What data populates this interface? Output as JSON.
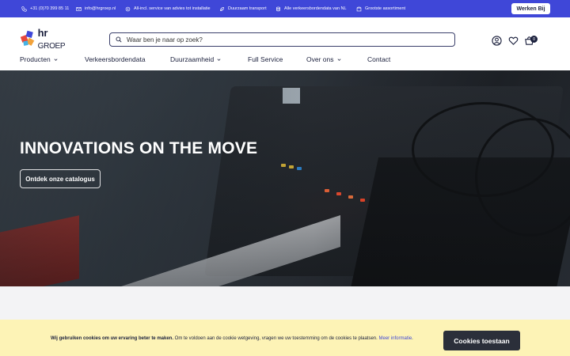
{
  "topbar": {
    "items": [
      {
        "icon": "phone-icon",
        "label": "+31 (0)70 399 85 11"
      },
      {
        "icon": "mail-icon",
        "label": "info@hrgroep.nl"
      },
      {
        "icon": "service-icon",
        "label": "All-incl. service van advies tot installatie"
      },
      {
        "icon": "leaf-icon",
        "label": "Duurzaam transport"
      },
      {
        "icon": "database-icon",
        "label": "Alle verkeersbordendata van NL"
      },
      {
        "icon": "box-icon",
        "label": "Grootste assortiment"
      }
    ],
    "werken_bij": "Werken Bij"
  },
  "logo": {
    "text": "hr",
    "subtext": "GROEP"
  },
  "search": {
    "placeholder": "Waar ben je naar op zoek?"
  },
  "cart": {
    "count": "0"
  },
  "nav": {
    "items": [
      {
        "label": "Producten",
        "dropdown": true
      },
      {
        "label": "Verkeersbordendata",
        "dropdown": false
      },
      {
        "label": "Duurzaamheid",
        "dropdown": true
      },
      {
        "label": "Full Service",
        "dropdown": false
      },
      {
        "label": "Over ons",
        "dropdown": true
      },
      {
        "label": "Contact",
        "dropdown": false
      }
    ]
  },
  "hero": {
    "title": "INNOVATIONS ON THE MOVE",
    "button": "Ontdek onze catalogus"
  },
  "cookie": {
    "bold_text": "Wij gebruiken cookies om uw ervaring beter te maken.",
    "text": " Om te voldoen aan de cookie wetgeving, vragen we uw toestemming om de cookies te plaatsen. ",
    "link": "Meer informatie",
    "link_suffix": ".",
    "button": "Cookies toestaan"
  },
  "colors": {
    "topbar": "#3f47d8",
    "navy": "#1a1f3c",
    "cookie_bg": "#fdf3b6",
    "cookie_button": "#2b2f3a"
  }
}
